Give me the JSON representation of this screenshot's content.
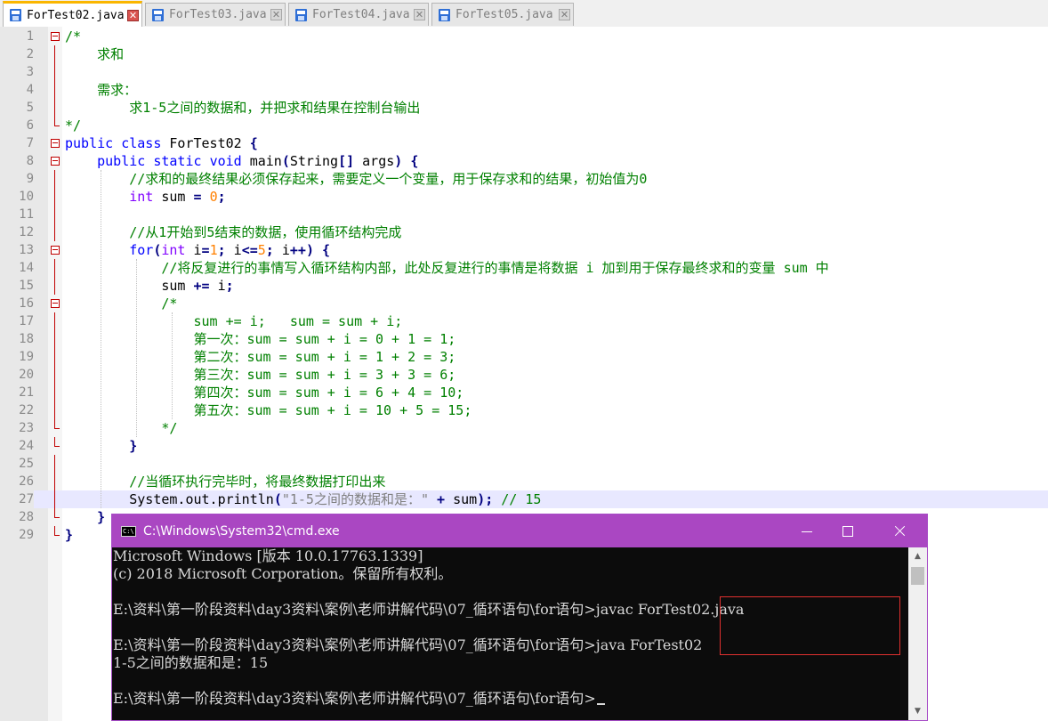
{
  "tabs": [
    {
      "label": "ForTest02.java",
      "active": true
    },
    {
      "label": "ForTest03.java",
      "active": false
    },
    {
      "label": "ForTest04.java",
      "active": false
    },
    {
      "label": "ForTest05.java",
      "active": false
    }
  ],
  "icons": {
    "file": "file-save-icon",
    "tab_close": "close-icon",
    "fold": "fold-minus-icon",
    "cmd": "cmd-icon",
    "minimize": "minimize-icon",
    "maximize": "maximize-icon",
    "close": "close-icon"
  },
  "editor": {
    "current_line": 27,
    "lines": [
      {
        "n": "1",
        "text": "/*"
      },
      {
        "n": "2",
        "text": "    求和"
      },
      {
        "n": "3",
        "text": ""
      },
      {
        "n": "4",
        "text": "    需求："
      },
      {
        "n": "5",
        "text": "        求1-5之间的数据和，并把求和结果在控制台输出"
      },
      {
        "n": "6",
        "text": "*/"
      },
      {
        "n": "7",
        "text": "public class ForTest02 {"
      },
      {
        "n": "8",
        "text": "    public static void main(String[] args) {"
      },
      {
        "n": "9",
        "text": "        //求和的最终结果必须保存起来，需要定义一个变量，用于保存求和的结果，初始值为0"
      },
      {
        "n": "10",
        "text": "        int sum = 0;"
      },
      {
        "n": "11",
        "text": ""
      },
      {
        "n": "12",
        "text": "        //从1开始到5结束的数据，使用循环结构完成"
      },
      {
        "n": "13",
        "text": "        for(int i=1; i<=5; i++) {"
      },
      {
        "n": "14",
        "text": "            //将反复进行的事情写入循环结构内部，此处反复进行的事情是将数据 i 加到用于保存最终求和的变量 sum 中"
      },
      {
        "n": "15",
        "text": "            sum += i;"
      },
      {
        "n": "16",
        "text": "            /*"
      },
      {
        "n": "17",
        "text": "                sum += i;   sum = sum + i;"
      },
      {
        "n": "18",
        "text": "                第一次：sum = sum + i = 0 + 1 = 1;"
      },
      {
        "n": "19",
        "text": "                第二次：sum = sum + i = 1 + 2 = 3;"
      },
      {
        "n": "20",
        "text": "                第三次：sum = sum + i = 3 + 3 = 6;"
      },
      {
        "n": "21",
        "text": "                第四次：sum = sum + i = 6 + 4 = 10;"
      },
      {
        "n": "22",
        "text": "                第五次：sum = sum + i = 10 + 5 = 15;"
      },
      {
        "n": "23",
        "text": "            */"
      },
      {
        "n": "24",
        "text": "        }"
      },
      {
        "n": "25",
        "text": ""
      },
      {
        "n": "26",
        "text": "        //当循环执行完毕时，将最终数据打印出来"
      },
      {
        "n": "27",
        "text": "        System.out.println(\"1-5之间的数据和是：\" + sum); // 15"
      },
      {
        "n": "28",
        "text": "    }"
      },
      {
        "n": "29",
        "text": "}"
      }
    ]
  },
  "cmd": {
    "title": "C:\\Windows\\System32\\cmd.exe",
    "lines": [
      "Microsoft Windows [版本 10.0.17763.1339]",
      "(c) 2018 Microsoft Corporation。保留所有权利。",
      "",
      "E:\\资料\\第一阶段资料\\day3资料\\案例\\老师讲解代码\\07_循环语句\\for语句>javac ForTest02.java",
      "",
      "E:\\资料\\第一阶段资料\\day3资料\\案例\\老师讲解代码\\07_循环语句\\for语句>java ForTest02",
      "1-5之间的数据和是：15",
      "",
      "E:\\资料\\第一阶段资料\\day3资料\\案例\\老师讲解代码\\07_循环语句\\for语句>"
    ]
  }
}
